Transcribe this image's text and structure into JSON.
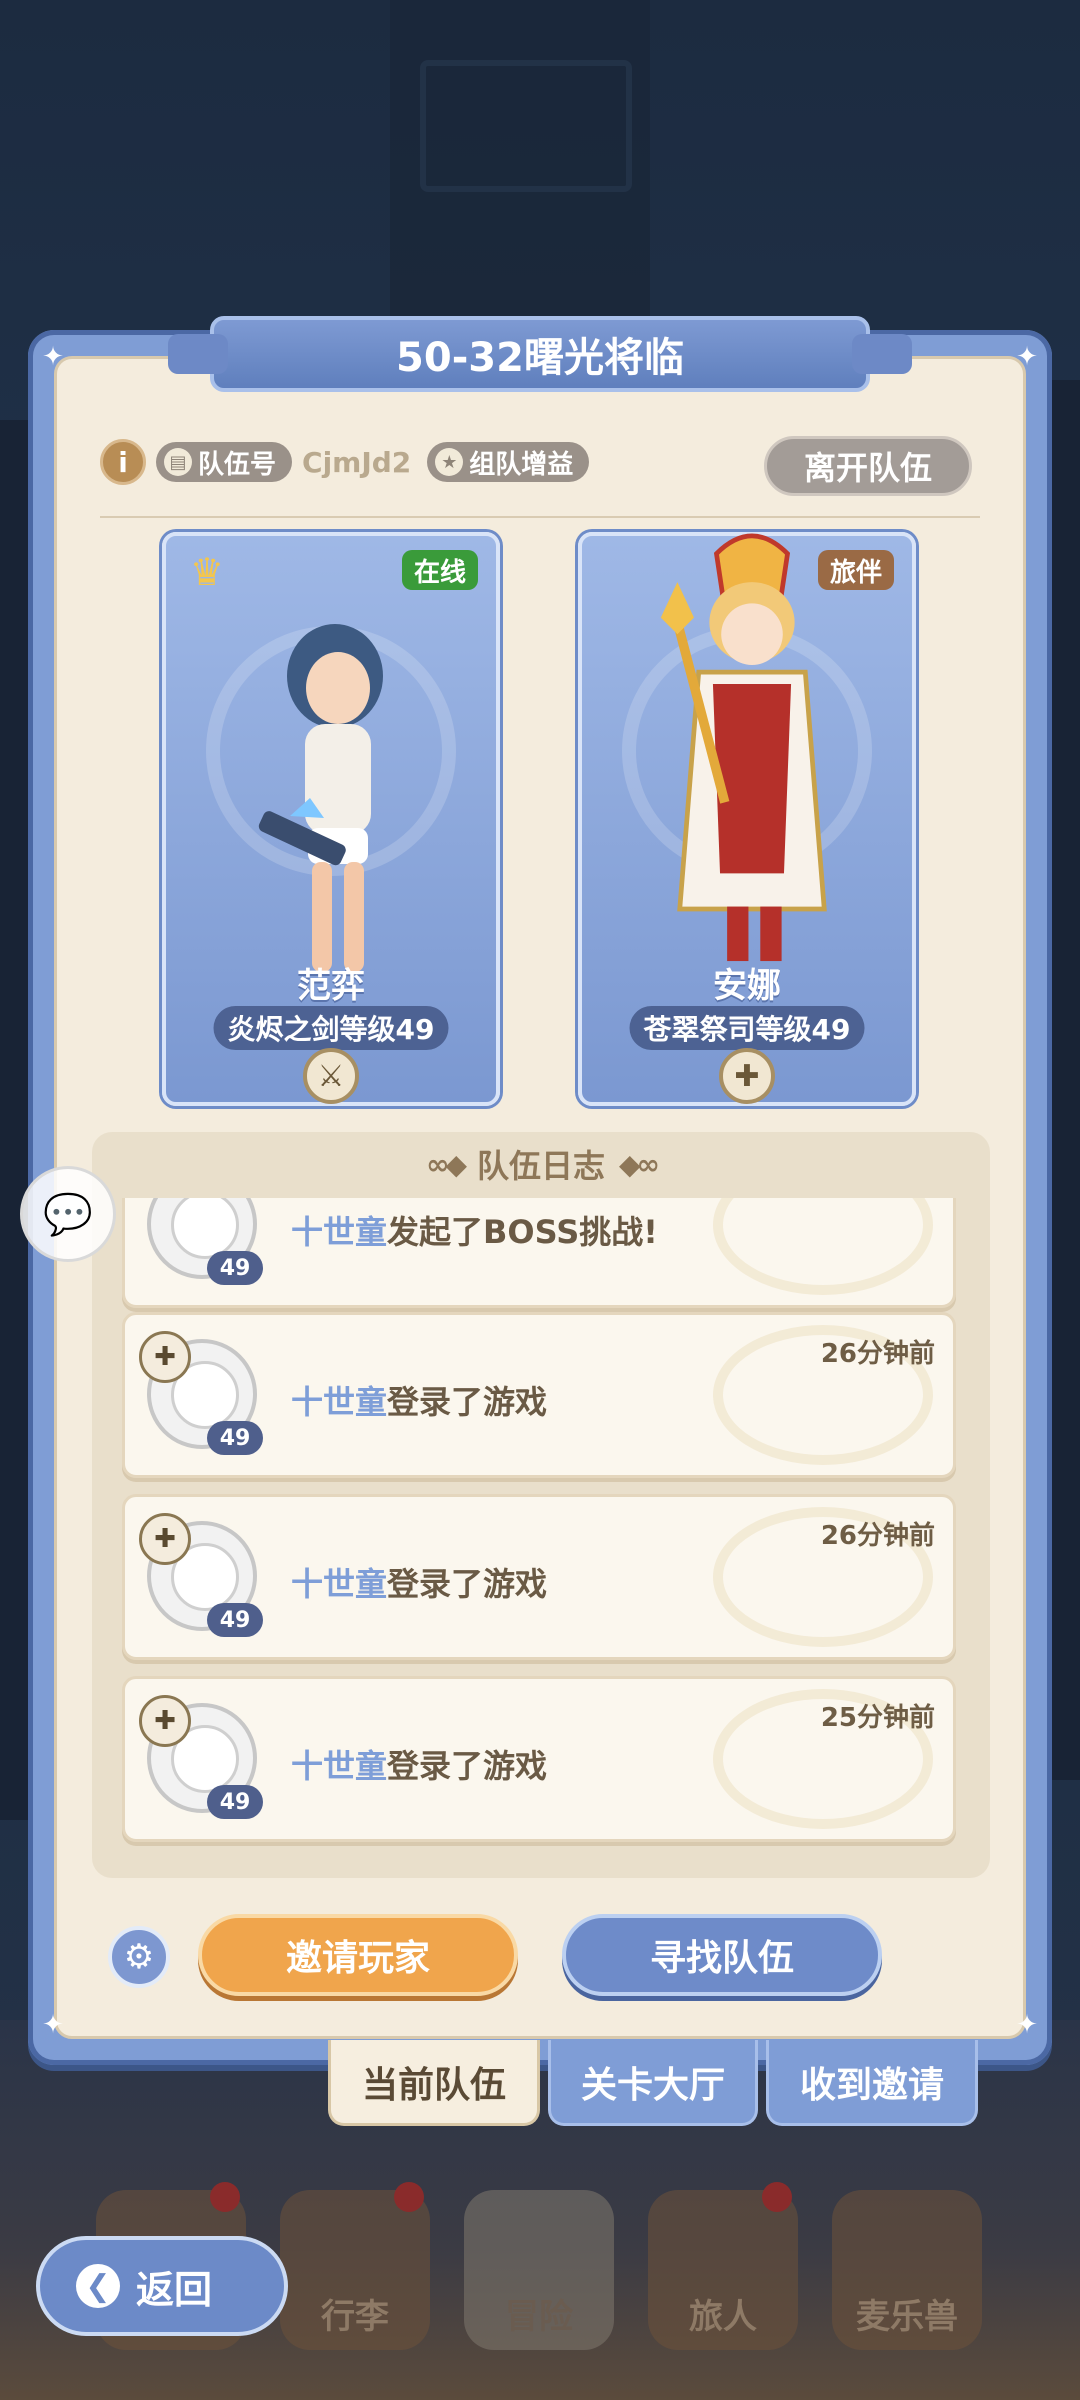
{
  "title": "50-32曙光将临",
  "info": {
    "info_icon": "i",
    "team_no_label": "队伍号",
    "team_code": "CjmJd2",
    "team_bonus_label": "组队增益",
    "leave_label": "离开队伍"
  },
  "members": [
    {
      "name": "范弈",
      "class_level": "炎烬之剑等级49",
      "badge": "在线",
      "badge_color": "#3a9b3a",
      "leader": true,
      "job_icon": "sword-icon"
    },
    {
      "name": "安娜",
      "class_level": "苍翠祭司等级49",
      "badge": "旅伴",
      "badge_color": "#9a6a45",
      "leader": false,
      "job_icon": "cross-icon"
    }
  ],
  "log": {
    "title": "队伍日志",
    "items": [
      {
        "player": "十世童",
        "action": "发起了BOSS挑战!",
        "time": "",
        "level": "49"
      },
      {
        "player": "十世童",
        "action": "登录了游戏",
        "time": "26分钟前",
        "level": "49"
      },
      {
        "player": "十世童",
        "action": "登录了游戏",
        "time": "26分钟前",
        "level": "49"
      },
      {
        "player": "十世童",
        "action": "登录了游戏",
        "time": "25分钟前",
        "level": "49"
      }
    ]
  },
  "actions": {
    "invite_label": "邀请玩家",
    "find_label": "寻找队伍"
  },
  "tabs": [
    "当前队伍",
    "关卡大厅",
    "收到邀请"
  ],
  "nav": {
    "back_label": "返回",
    "items": [
      "行李",
      "冒险",
      "旅人",
      "麦乐兽"
    ]
  },
  "colors": {
    "accent_blue": "#7f9dd5",
    "invite_orange": "#f0a54c",
    "panel_cream": "#f4ecdd",
    "player_name_blue": "#7e9ed8"
  }
}
